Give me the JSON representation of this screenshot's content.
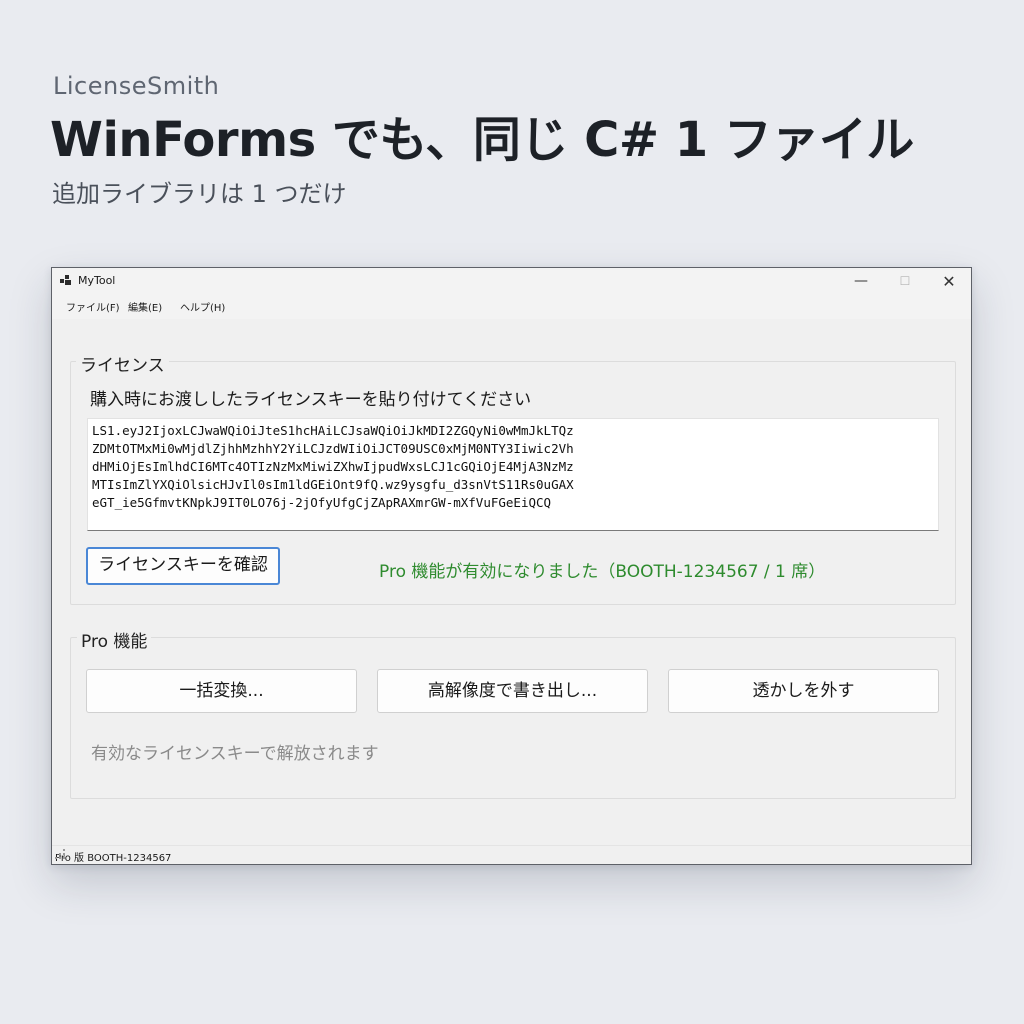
{
  "hero": {
    "brand": "LicenseSmith",
    "headline": "WinForms でも、同じ C# 1 ファイル",
    "subline": "追加ライブラリは 1 つだけ"
  },
  "window": {
    "title": "MyTool",
    "controls": {
      "minimize": "—",
      "maximize": "☐",
      "close": "✕"
    },
    "menu": [
      "ファイル(F)",
      "編集(E)",
      "ヘルプ(H)"
    ]
  },
  "license_group": {
    "title": "ライセンス",
    "prompt": "購入時にお渡ししたライセンスキーを貼り付けてください",
    "key_lines": [
      "LS1.eyJ2IjoxLCJwaWQiOiJteS1hcHAiLCJsaWQiOiJkMDI2ZGQyNi0wMmJkLTQz",
      "ZDMtOTMxMi0wMjdlZjhhMzhhY2YiLCJzdWIiOiJCT09USC0xMjM0NTY3Iiwic2Vh",
      "dHMiOjEsImlhdCI6MTc4OTIzNzMxMiwiZXhwIjpudWxsLCJ1cGQiOjE4MjA3NzMz",
      "MTIsImZlYXQiOlsicHJvIl0sIm1ldGEiOnt9fQ.wz9ysgfu_d3snVtS11Rs0uGAX",
      "eGT_ie5GfmvtKNpkJ9IT0LO76j-2jOfyUfgCjZApRAXmrGW-mXfVuFGeEiQCQ"
    ],
    "verify_button": "ライセンスキーを確認",
    "status": "Pro 機能が有効になりました（BOOTH-1234567 / 1 席）"
  },
  "pro_group": {
    "title": "Pro 機能",
    "buttons": [
      "一括変換...",
      "高解像度で書き出し...",
      "透かしを外す"
    ],
    "hint": "有効なライセンスキーで解放されます"
  },
  "statusbar": {
    "text": "Pro 版  BOOTH-1234567"
  },
  "colors": {
    "background": "#e9ebf0",
    "accent_border": "#4a87d6",
    "success_text": "#2e8b2e",
    "hint_text": "#8a8a8a"
  },
  "icons": [
    "app-icon",
    "minimize-icon",
    "maximize-icon",
    "close-icon",
    "resize-grip-icon"
  ]
}
